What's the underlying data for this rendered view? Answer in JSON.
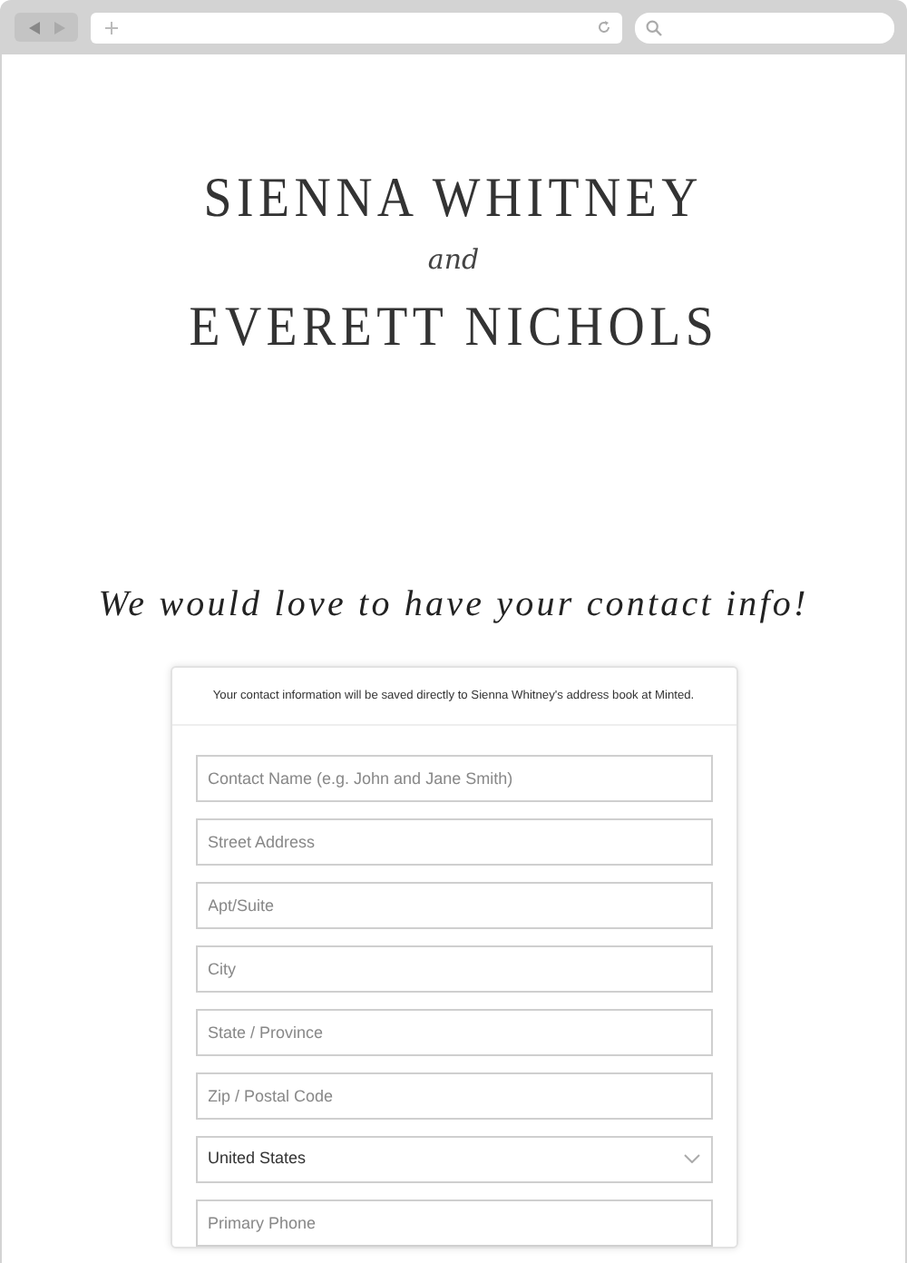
{
  "header": {
    "first_name": "SIENNA WHITNEY",
    "joiner": "and",
    "second_name": "EVERETT NICHOLS"
  },
  "heading": "We would love to have your contact info!",
  "form": {
    "notice": "Your contact information will be saved directly to Sienna Whitney's address book at Minted.",
    "fields": [
      {
        "kind": "text",
        "placeholder": "Contact Name (e.g. John and Jane Smith)"
      },
      {
        "kind": "text",
        "placeholder": "Street Address"
      },
      {
        "kind": "text",
        "placeholder": "Apt/Suite"
      },
      {
        "kind": "text",
        "placeholder": "City"
      },
      {
        "kind": "text",
        "placeholder": "State / Province"
      },
      {
        "kind": "text",
        "placeholder": "Zip / Postal Code"
      },
      {
        "kind": "select",
        "value": "United States"
      },
      {
        "kind": "text",
        "placeholder": "Primary Phone"
      }
    ]
  }
}
